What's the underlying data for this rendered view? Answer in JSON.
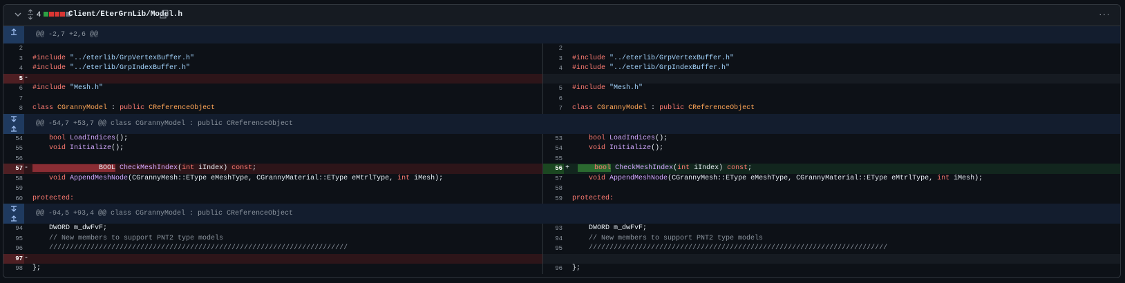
{
  "header": {
    "changes_count": "4",
    "file_path": "Client/EterGrnLib/Model.h",
    "bar_colors": [
      "#2ea043",
      "#da3633",
      "#da3633",
      "#da3633",
      "#6e7681"
    ]
  },
  "hunks": [
    "@@ -2,7 +2,6 @@",
    "@@ -54,7 +53,7 @@ class CGrannyModel : public CReferenceObject",
    "@@ -94,5 +93,4 @@ class CGrannyModel : public CReferenceObject"
  ],
  "lines": {
    "l2": "2",
    "r2": "2",
    "l3": "3",
    "r3": "3",
    "l4": "4",
    "r4": "4",
    "l5": "5",
    "l6": "6",
    "r5": "5",
    "l7": "7",
    "r6": "6",
    "l8": "8",
    "r7": "7",
    "l54": "54",
    "r53": "53",
    "l55": "55",
    "r54": "54",
    "l56": "56",
    "r55": "55",
    "l57": "57",
    "r56": "56",
    "l58": "58",
    "r57": "57",
    "l59": "59",
    "r58": "58",
    "l60": "60",
    "r59": "59",
    "l94": "94",
    "r93": "93",
    "l95": "95",
    "r94": "94",
    "l96": "96",
    "r95": "95",
    "l97": "97",
    "l98": "98",
    "r96": "96"
  },
  "code": {
    "include": "#include",
    "vb": "\"../eterlib/GrpVertexBuffer.h\"",
    "ib": "\"../eterlib/GrpIndexBuffer.h\"",
    "mesh": "\"Mesh.h\"",
    "class_kw": "class",
    "class_name": "CGrannyModel",
    "colon": " : ",
    "public_kw": "public",
    "base": "CReferenceObject",
    "bool_kw": "bool",
    "load": "LoadIndices",
    "parens": "();",
    "void_kw": "void",
    "init": "Initialize",
    "BOOL": "BOOL",
    "check": "CheckMeshIndex",
    "int_kw": "int",
    "iIndex": " iIndex)",
    "const_kw": "const",
    "append": "AppendMeshNode",
    "append_args_1": "(CGrannyMesh::EType eMeshType, CGrannyMaterial::EType eMtrlType,",
    "append_args_2": " iMesh);",
    "protected": "protected:",
    "dword": "DWORD m_dwFvF;",
    "comment": "// New members to support PNT2 type models",
    "slashes": "////////////////////////////////////////////////////////////////////////",
    "close": "};",
    "minus": "-",
    "plus": "+"
  }
}
